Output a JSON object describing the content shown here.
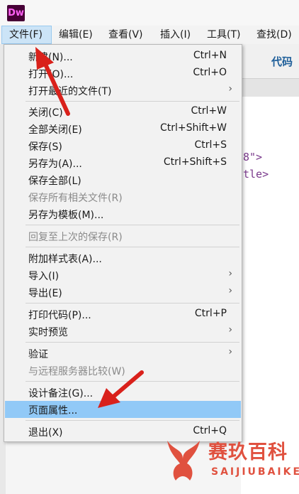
{
  "app": {
    "logo_text": "Dw"
  },
  "menubar": {
    "items": [
      {
        "label": "文件(F)",
        "active": true
      },
      {
        "label": "编辑(E)"
      },
      {
        "label": "查看(V)"
      },
      {
        "label": "插入(I)"
      },
      {
        "label": "工具(T)"
      },
      {
        "label": "查找(D)"
      }
    ]
  },
  "toolbar": {
    "code_tab": "代码"
  },
  "editor": {
    "line1": "8\">",
    "line2": "tle>"
  },
  "file_menu": {
    "items": [
      {
        "label": "新建(N)...",
        "shortcut": "Ctrl+N"
      },
      {
        "label": "打开(O)...",
        "shortcut": "Ctrl+O"
      },
      {
        "label": "打开最近的文件(T)",
        "submenu": true
      },
      {
        "label": "关闭(C)",
        "shortcut": "Ctrl+W"
      },
      {
        "label": "全部关闭(E)",
        "shortcut": "Ctrl+Shift+W"
      },
      {
        "label": "保存(S)",
        "shortcut": "Ctrl+S"
      },
      {
        "label": "另存为(A)...",
        "shortcut": "Ctrl+Shift+S"
      },
      {
        "label": "保存全部(L)"
      },
      {
        "label": "保存所有相关文件(R)",
        "disabled": true
      },
      {
        "label": "另存为模板(M)..."
      },
      {
        "label": "回复至上次的保存(R)",
        "disabled": true
      },
      {
        "label": "附加样式表(A)..."
      },
      {
        "label": "导入(I)",
        "submenu": true
      },
      {
        "label": "导出(E)",
        "submenu": true
      },
      {
        "label": "打印代码(P)...",
        "shortcut": "Ctrl+P"
      },
      {
        "label": "实时预览",
        "submenu": true
      },
      {
        "label": "验证",
        "submenu": true
      },
      {
        "label": "与远程服务器比较(W)",
        "disabled": true
      },
      {
        "label": "设计备注(G)..."
      },
      {
        "label": "页面属性...",
        "highlighted": true
      },
      {
        "label": "退出(X)",
        "shortcut": "Ctrl+Q"
      }
    ],
    "submenu_glyph": "›"
  },
  "watermark": {
    "chinese": "赛玖百科",
    "english": "SAIJIUBAIKE"
  },
  "colors": {
    "accent_highlight": "#91c9f7",
    "annotation_red": "#d9211b",
    "logo_bg": "#470137",
    "logo_fg": "#ff61f6",
    "watermark": "#e0513f"
  }
}
